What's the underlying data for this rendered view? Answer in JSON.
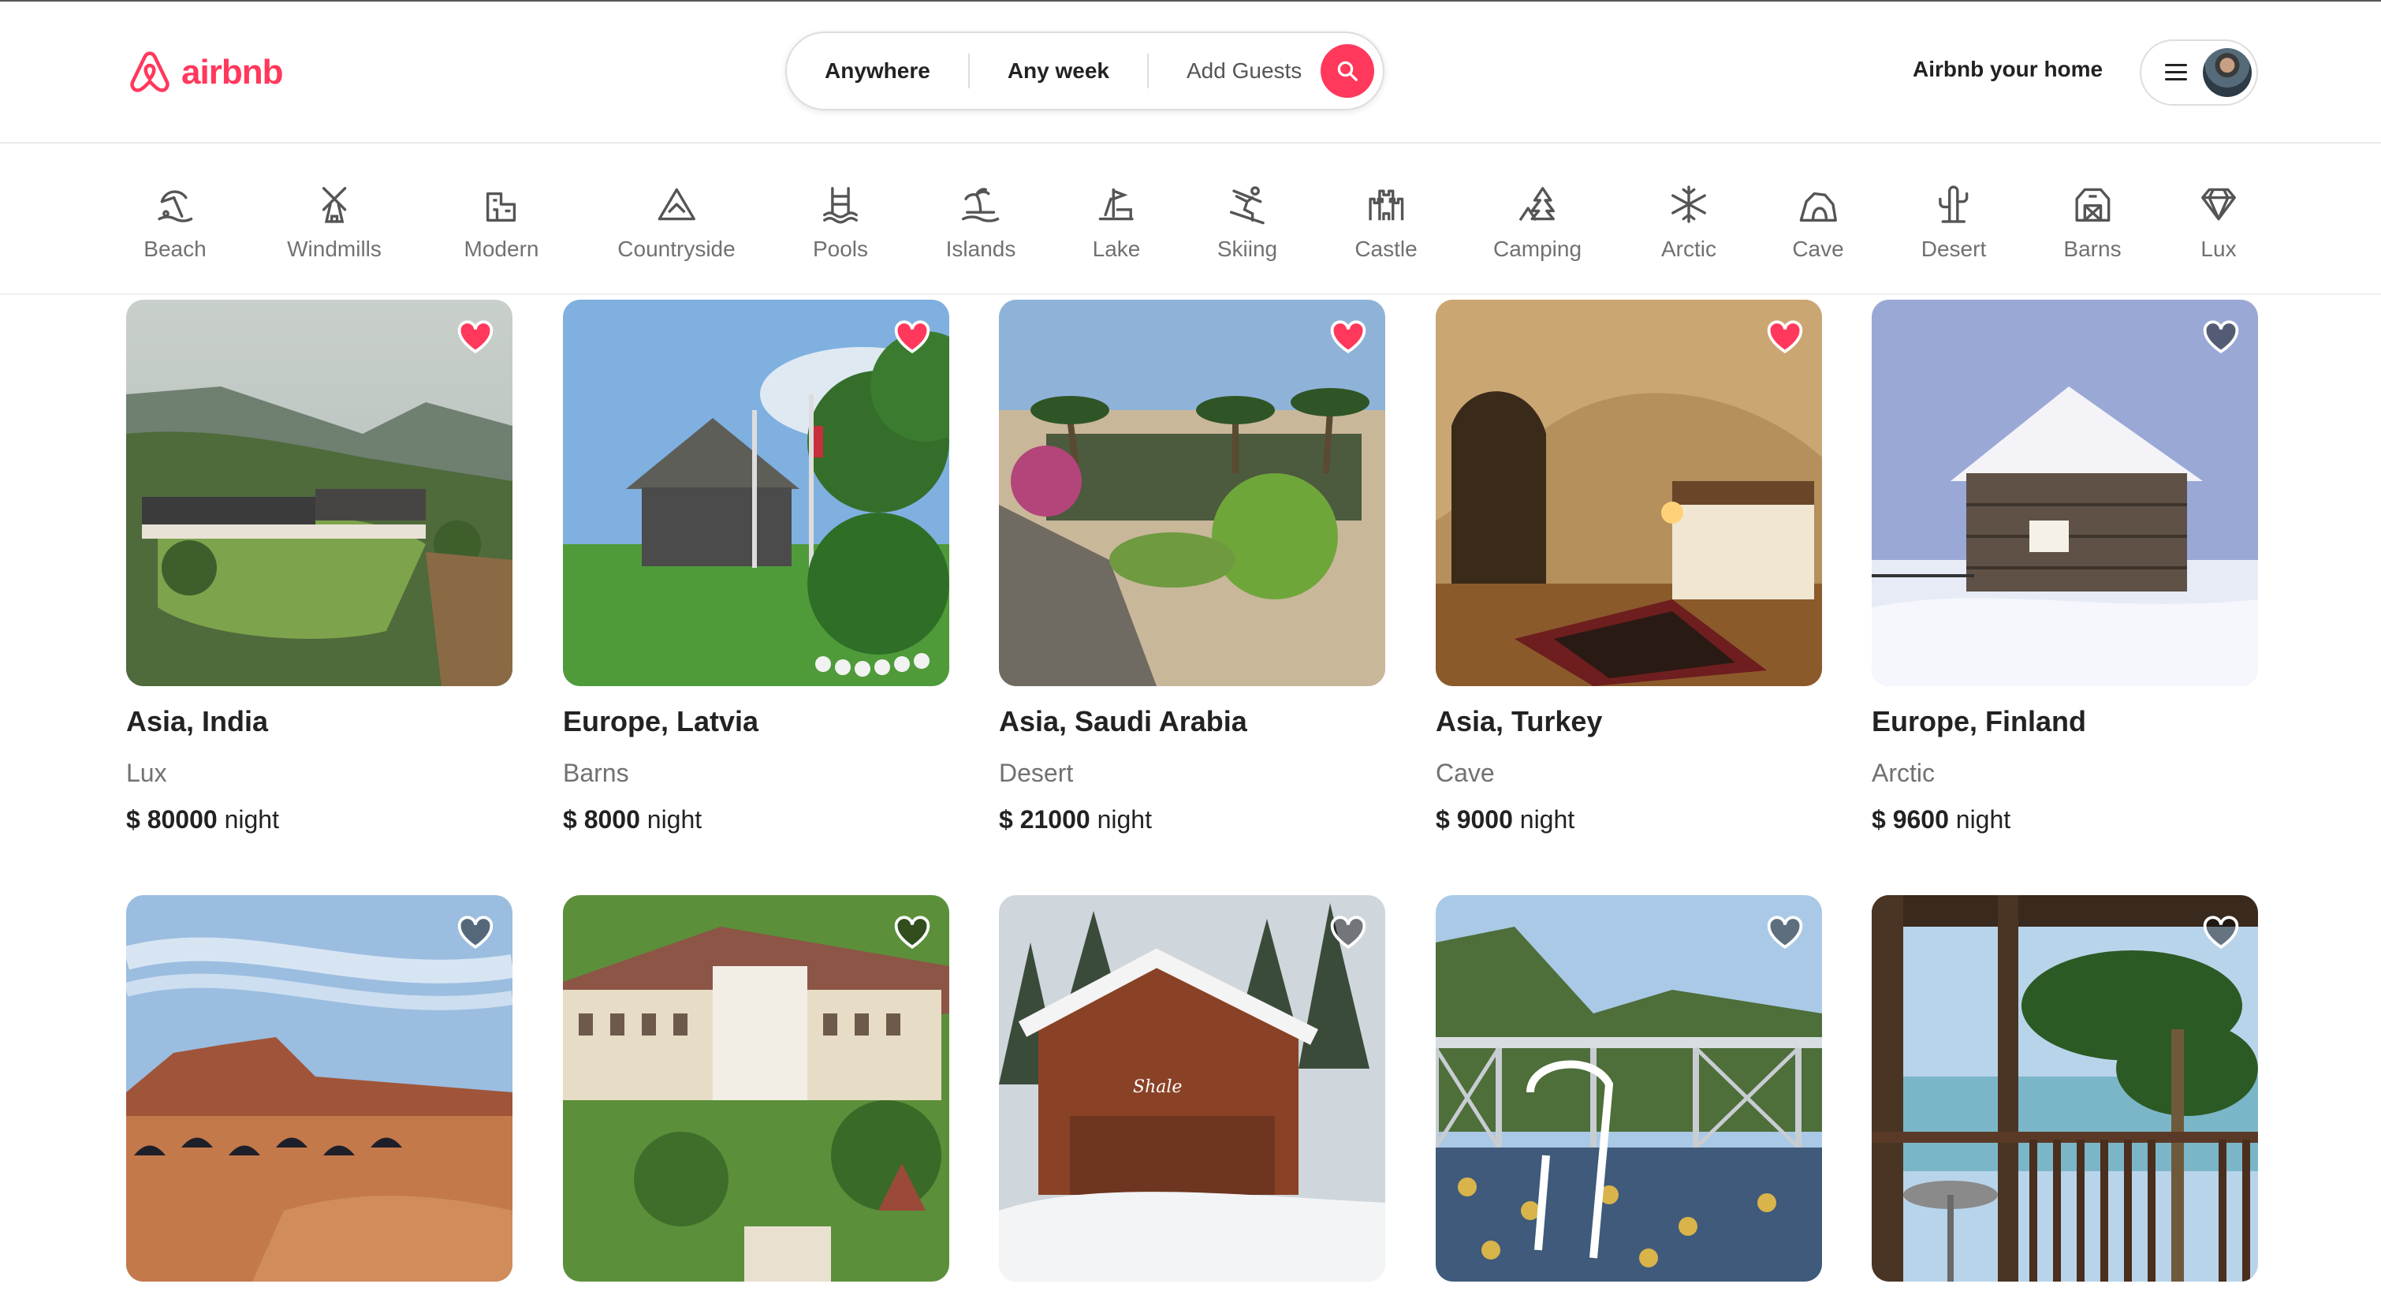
{
  "brand": {
    "name": "airbnb",
    "color": "#ff385c"
  },
  "search": {
    "where": "Anywhere",
    "when": "Any week",
    "guests": "Add Guests"
  },
  "header": {
    "host_link": "Airbnb your home"
  },
  "categories": [
    {
      "label": "Beach",
      "icon": "beach-icon"
    },
    {
      "label": "Windmills",
      "icon": "windmill-icon"
    },
    {
      "label": "Modern",
      "icon": "modern-house-icon"
    },
    {
      "label": "Countryside",
      "icon": "mountain-icon"
    },
    {
      "label": "Pools",
      "icon": "pool-icon"
    },
    {
      "label": "Islands",
      "icon": "island-icon"
    },
    {
      "label": "Lake",
      "icon": "lake-icon"
    },
    {
      "label": "Skiing",
      "icon": "skiing-icon"
    },
    {
      "label": "Castle",
      "icon": "castle-icon"
    },
    {
      "label": "Camping",
      "icon": "camping-icon"
    },
    {
      "label": "Arctic",
      "icon": "snowflake-icon"
    },
    {
      "label": "Cave",
      "icon": "cave-icon"
    },
    {
      "label": "Desert",
      "icon": "cactus-icon"
    },
    {
      "label": "Barns",
      "icon": "barn-icon"
    },
    {
      "label": "Lux",
      "icon": "diamond-icon"
    }
  ],
  "listings": [
    {
      "location": "Asia, India",
      "category": "Lux",
      "price": "$ 80000",
      "unit": "night",
      "favorited": true
    },
    {
      "location": "Europe, Latvia",
      "category": "Barns",
      "price": "$ 8000",
      "unit": "night",
      "favorited": true
    },
    {
      "location": "Asia, Saudi Arabia",
      "category": "Desert",
      "price": "$ 21000",
      "unit": "night",
      "favorited": true
    },
    {
      "location": "Asia, Turkey",
      "category": "Cave",
      "price": "$ 9000",
      "unit": "night",
      "favorited": true
    },
    {
      "location": "Europe, Finland",
      "category": "Arctic",
      "price": "$ 9600",
      "unit": "night",
      "favorited": false
    },
    {
      "favorited": false
    },
    {
      "favorited": false
    },
    {
      "favorited": false,
      "photo_text": "Shale"
    },
    {
      "favorited": false
    },
    {
      "favorited": false
    }
  ]
}
